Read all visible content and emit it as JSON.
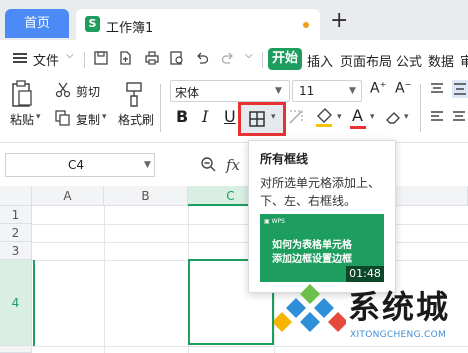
{
  "tabs": {
    "home_label": "首页",
    "doc_title": "工作簿1",
    "doc_icon_letter": "S",
    "add_label": "+"
  },
  "menu": {
    "file_label": "文件",
    "start_label": "开始",
    "items": [
      "插入",
      "页面布局",
      "公式",
      "数据",
      "审"
    ]
  },
  "ribbon": {
    "paste_label": "粘贴",
    "cut_label": "剪切",
    "copy_label": "复制",
    "format_painter_label": "格式刷",
    "font_name": "宋体",
    "font_size": "11",
    "bold": "B",
    "italic": "I",
    "underline": "U"
  },
  "formula_bar": {
    "cell_ref": "C4",
    "fx": "fx"
  },
  "grid": {
    "columns": [
      "A",
      "B",
      "C"
    ],
    "rows": [
      "1",
      "2",
      "3",
      "4"
    ],
    "selected_cell": "C4"
  },
  "tooltip": {
    "title": "所有框线",
    "description": "对所选单元格添加上、下、左、右框线。",
    "video_line1": "如何为表格单元格",
    "video_line2": "添加边框设置边框",
    "video_duration": "01:48"
  },
  "watermark": {
    "name": "系统城",
    "url": "XITONGCHENG.COM"
  },
  "colors": {
    "accent": "#1e9e5e",
    "home_tab": "#4c8bf5",
    "highlight_border": "#e63232"
  }
}
